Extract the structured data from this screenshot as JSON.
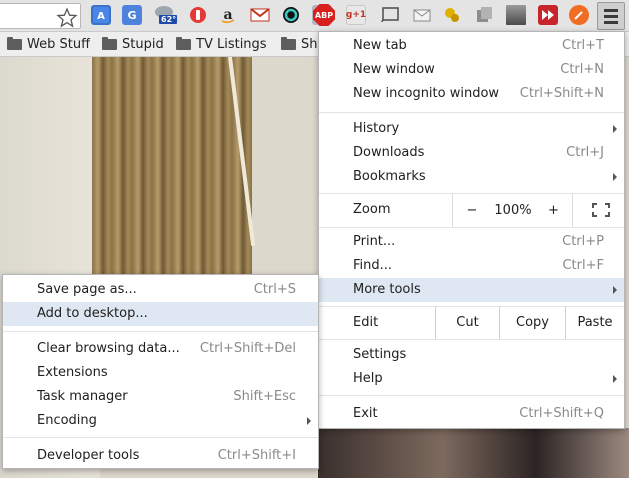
{
  "toolbar": {
    "zoom_badge": "62°",
    "adblock_label": "ABP",
    "gplus_label": "g+1"
  },
  "bookmarks": [
    {
      "label": "Web Stuff"
    },
    {
      "label": "Stupid"
    },
    {
      "label": "TV Listings"
    },
    {
      "label": "Sh"
    }
  ],
  "menu": {
    "new_tab": {
      "label": "New tab",
      "shortcut": "Ctrl+T"
    },
    "new_window": {
      "label": "New window",
      "shortcut": "Ctrl+N"
    },
    "new_incognito": {
      "label": "New incognito window",
      "shortcut": "Ctrl+Shift+N"
    },
    "history": {
      "label": "History"
    },
    "downloads": {
      "label": "Downloads",
      "shortcut": "Ctrl+J"
    },
    "bookmarks": {
      "label": "Bookmarks"
    },
    "zoom": {
      "label": "Zoom",
      "minus": "−",
      "value": "100%",
      "plus": "+"
    },
    "print": {
      "label": "Print...",
      "shortcut": "Ctrl+P"
    },
    "find": {
      "label": "Find...",
      "shortcut": "Ctrl+F"
    },
    "more_tools": {
      "label": "More tools"
    },
    "edit": {
      "label": "Edit",
      "cut": "Cut",
      "copy": "Copy",
      "paste": "Paste"
    },
    "settings": {
      "label": "Settings"
    },
    "help": {
      "label": "Help"
    },
    "exit": {
      "label": "Exit",
      "shortcut": "Ctrl+Shift+Q"
    }
  },
  "submenu": {
    "save_page": {
      "label": "Save page as...",
      "shortcut": "Ctrl+S"
    },
    "add_desktop": {
      "label": "Add to desktop..."
    },
    "clear_data": {
      "label": "Clear browsing data...",
      "shortcut": "Ctrl+Shift+Del"
    },
    "extensions": {
      "label": "Extensions"
    },
    "task_manager": {
      "label": "Task manager",
      "shortcut": "Shift+Esc"
    },
    "encoding": {
      "label": "Encoding"
    },
    "dev_tools": {
      "label": "Developer tools",
      "shortcut": "Ctrl+Shift+I"
    }
  },
  "colors": {
    "highlight": "#dfe8f2",
    "toolbar_bg": "#e4e4e4",
    "shortcut_text": "#8a8a8a"
  }
}
